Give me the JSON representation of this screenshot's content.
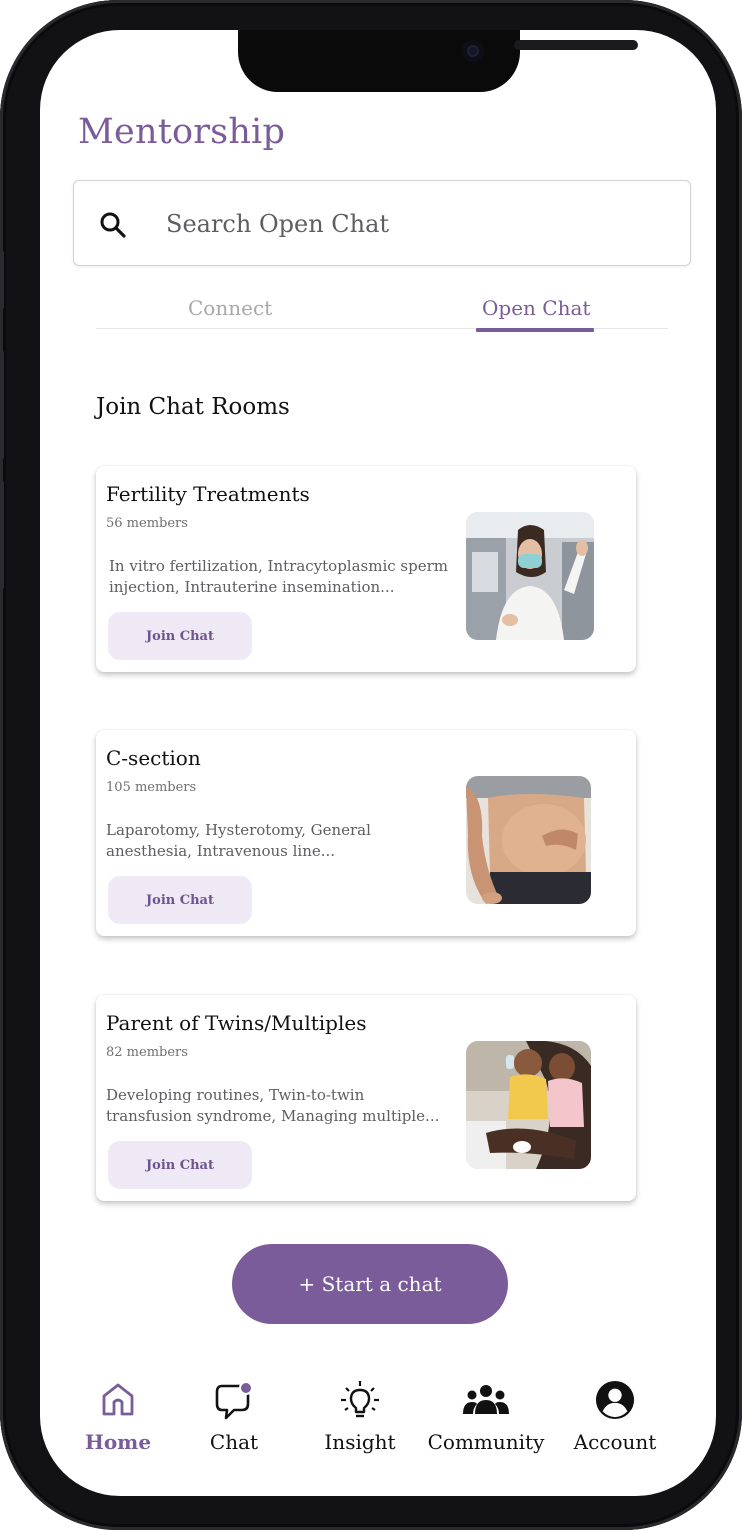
{
  "app": {
    "title": "Mentorship",
    "accent_color": "#7a5c9a"
  },
  "search": {
    "placeholder": "Search Open Chat",
    "value": "",
    "icon": "search-icon"
  },
  "tabs": [
    {
      "label": "Connect",
      "active": false
    },
    {
      "label": "Open Chat",
      "active": true
    }
  ],
  "section": {
    "title": "Join Chat Rooms"
  },
  "rooms": [
    {
      "name": "Fertility Treatments",
      "members": "56 members",
      "description": "In vitro fertilization, Intracytoplasmic sperm injection, Intrauterine insemination...",
      "button": "Join Chat",
      "image": "lab-doctor-photo"
    },
    {
      "name": "C-section",
      "members": "105 members",
      "description": "Laparotomy, Hysterotomy, General anesthesia, Intravenous line...",
      "button": "Join Chat",
      "image": "pregnant-belly-photo"
    },
    {
      "name": "Parent of Twins/Multiples",
      "members": "82 members",
      "description": "Developing routines, Twin-to-twin transfusion syndrome, Managing multiple...",
      "button": "Join Chat",
      "image": "parent-twins-photo"
    }
  ],
  "start_chat": {
    "label": "+ Start a chat"
  },
  "bottom_nav": [
    {
      "label": "Home",
      "icon": "home-icon",
      "active": true
    },
    {
      "label": "Chat",
      "icon": "chat-bubble-icon",
      "active": false
    },
    {
      "label": "Insight",
      "icon": "lightbulb-icon",
      "active": false
    },
    {
      "label": "Community",
      "icon": "community-icon",
      "active": false
    },
    {
      "label": "Account",
      "icon": "account-icon",
      "active": false
    }
  ]
}
